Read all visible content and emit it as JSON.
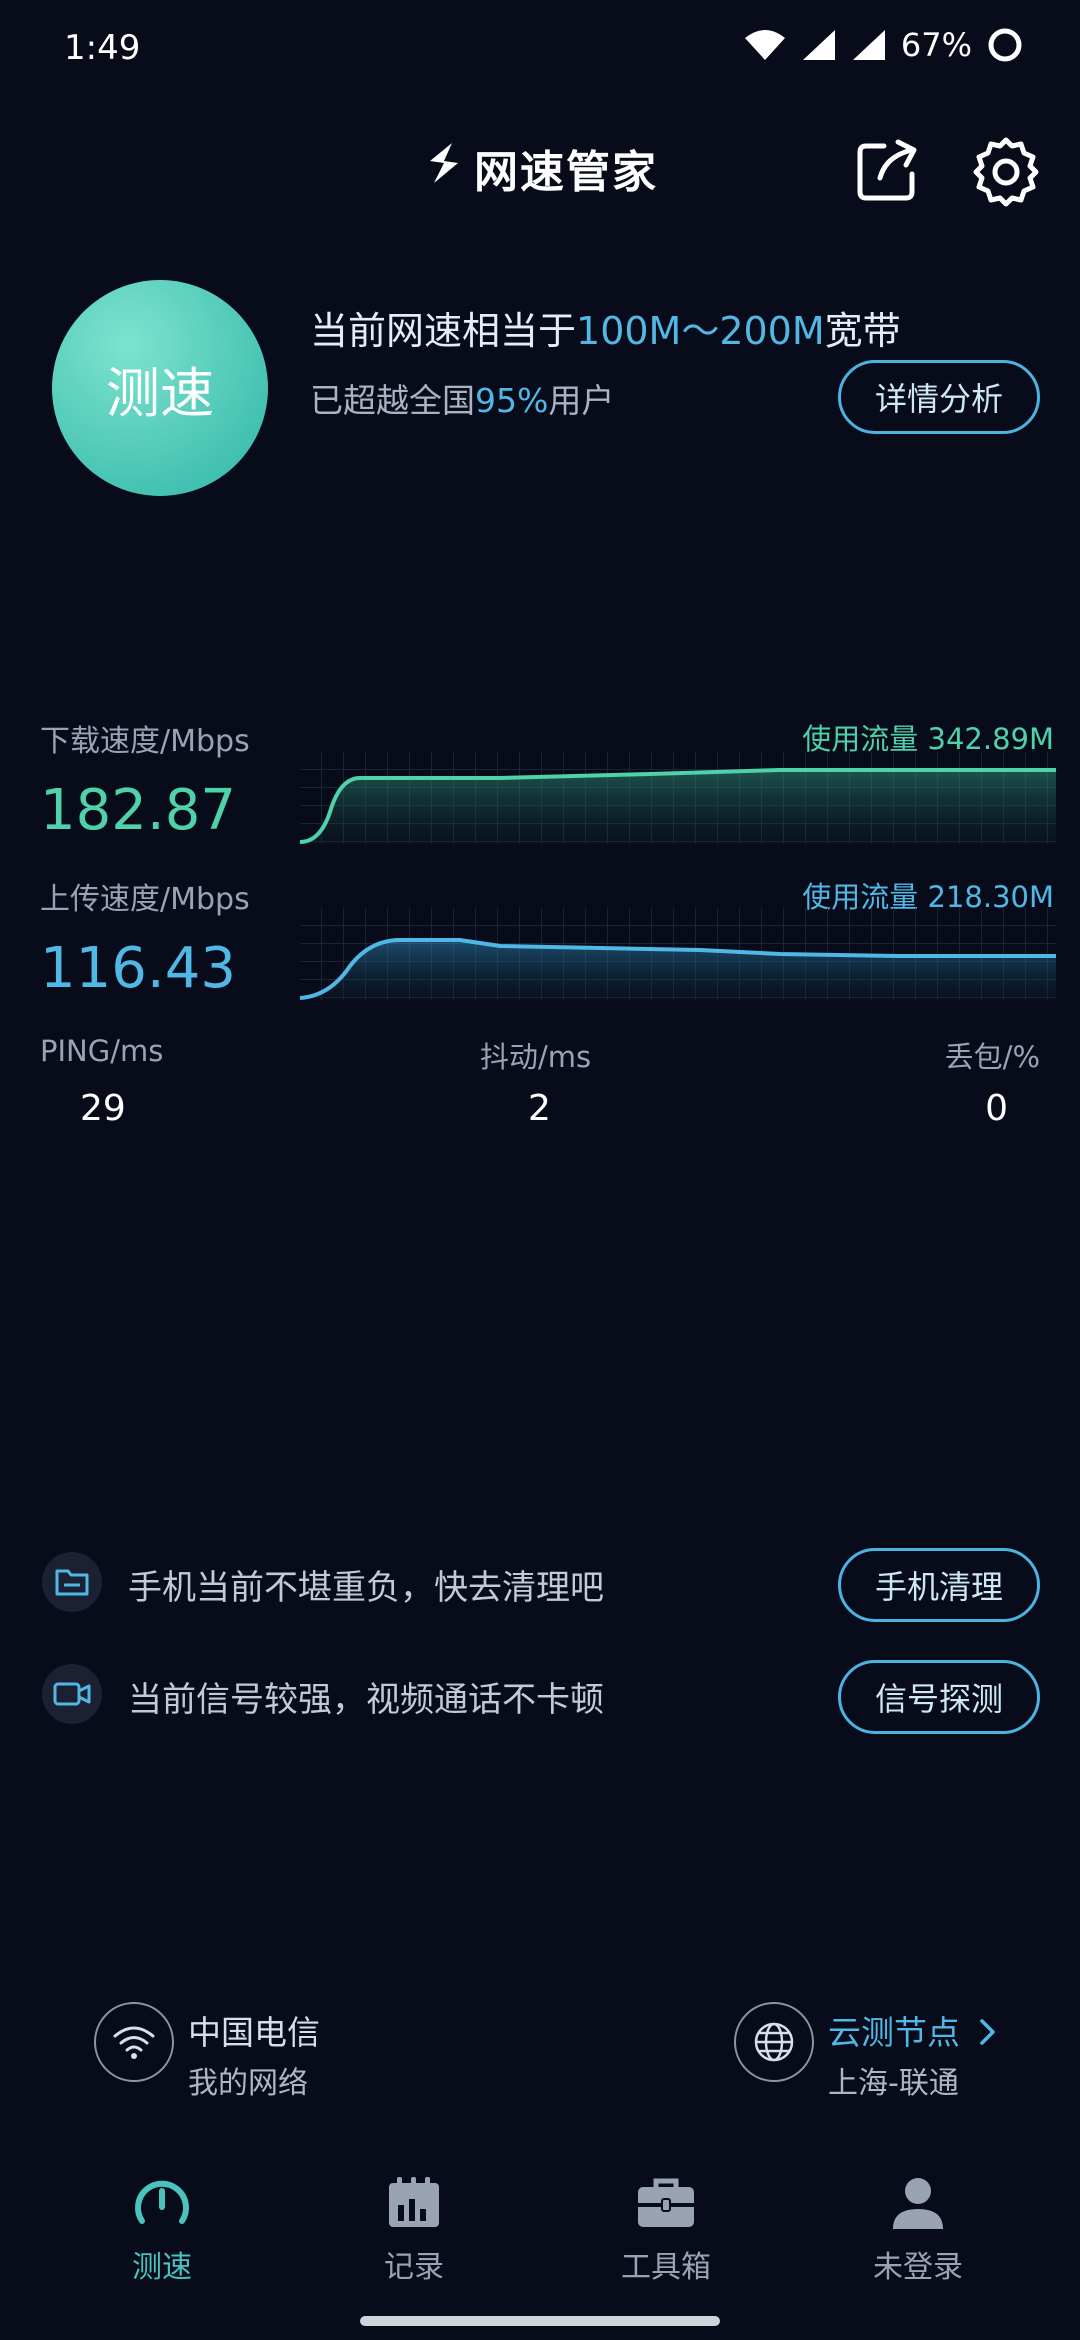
{
  "status_bar": {
    "time": "1:49",
    "battery": "67%"
  },
  "header": {
    "app_title": "网速管家"
  },
  "speed_button": {
    "label": "测速"
  },
  "summary": {
    "line1_prefix": "当前网速相当于",
    "line1_highlight": "100M～200M",
    "line1_suffix": "宽带",
    "line2_prefix": "已超越全国",
    "line2_highlight": "95%",
    "line2_suffix": "用户",
    "details_button": "详情分析"
  },
  "download": {
    "label": "下载速度/Mbps",
    "value": "182.87",
    "usage": "使用流量 342.89M",
    "color": "#4fd1a9"
  },
  "upload": {
    "label": "上传速度/Mbps",
    "value": "116.43",
    "usage": "使用流量 218.30M",
    "color": "#4fb8e6"
  },
  "stats": {
    "ping_label": "PING/ms",
    "ping_value": "29",
    "jitter_label": "抖动/ms",
    "jitter_value": "2",
    "loss_label": "丢包/%",
    "loss_value": "0"
  },
  "tips": [
    {
      "text": "手机当前不堪重负，快去清理吧",
      "button": "手机清理",
      "icon": "folder-icon"
    },
    {
      "text": "当前信号较强，视频通话不卡顿",
      "button": "信号探测",
      "icon": "video-icon"
    }
  ],
  "network": {
    "carrier": "中国电信",
    "sub": "我的网络",
    "icon": "wifi-icon"
  },
  "node": {
    "title": "云测节点",
    "sub": "上海-联通",
    "icon": "globe-icon"
  },
  "tabs": [
    {
      "label": "测速",
      "icon": "speedometer-icon",
      "active": true
    },
    {
      "label": "记录",
      "icon": "calendar-chart-icon",
      "active": false
    },
    {
      "label": "工具箱",
      "icon": "toolbox-icon",
      "active": false
    },
    {
      "label": "未登录",
      "icon": "user-icon",
      "active": false
    }
  ]
}
